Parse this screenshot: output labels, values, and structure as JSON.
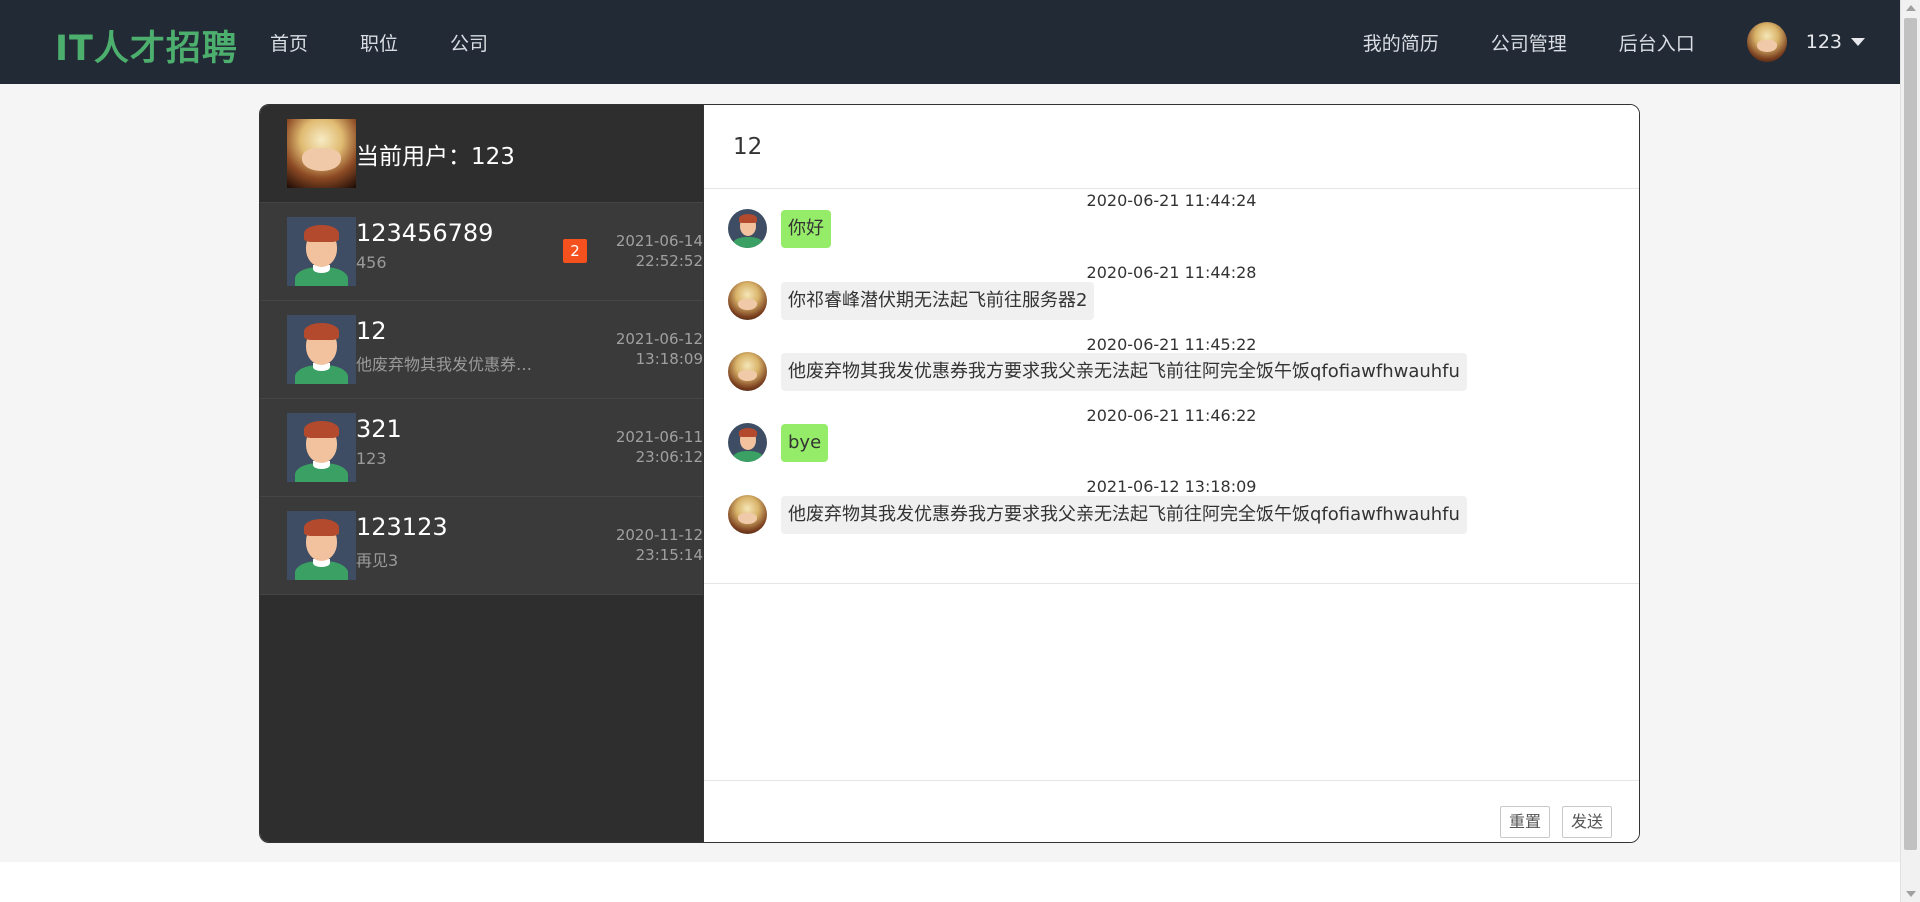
{
  "nav": {
    "brand": "IT人才招聘",
    "left_links": [
      "首页",
      "职位",
      "公司"
    ],
    "right_links": [
      "我的简历",
      "公司管理",
      "后台入口"
    ],
    "user_name": "123"
  },
  "sidebar": {
    "current_user_label": "当前用户：123",
    "contacts": [
      {
        "name": "123456789",
        "last_message": "456",
        "date": "2021-06-14",
        "time": "22:52:52",
        "badge": "2"
      },
      {
        "name": "12",
        "last_message": "他废弃物其我发优惠券…",
        "date": "2021-06-12",
        "time": "13:18:09"
      },
      {
        "name": "321",
        "last_message": "123",
        "date": "2021-06-11",
        "time": "23:06:12"
      },
      {
        "name": "123123",
        "last_message": "再见3",
        "date": "2020-11-12",
        "time": "23:15:14"
      }
    ]
  },
  "chat": {
    "title": "12",
    "messages": [
      {
        "timestamp": "2020-06-21 11:44:24",
        "text": "你好",
        "style": "green",
        "avatar": "male"
      },
      {
        "timestamp": "2020-06-21 11:44:28",
        "text": "你祁睿峰潜伏期无法起飞前往服务器2",
        "style": "grey",
        "avatar": "anime"
      },
      {
        "timestamp": "2020-06-21 11:45:22",
        "text": "他废弃物其我发优惠券我方要求我父亲无法起飞前往阿完全饭午饭qfofiawfhwauhfu",
        "style": "grey",
        "avatar": "anime"
      },
      {
        "timestamp": "2020-06-21 11:46:22",
        "text": "bye",
        "style": "green",
        "avatar": "male"
      },
      {
        "timestamp": "2021-06-12 13:18:09",
        "text": "他废弃物其我发优惠券我方要求我父亲无法起飞前往阿完全饭午饭qfofiawfhwauhfu",
        "style": "grey",
        "avatar": "anime"
      }
    ],
    "reset_label": "重置",
    "send_label": "发送"
  },
  "colors": {
    "topbar": "#222a36",
    "brand": "#4caf6e",
    "sidebar": "#2e2e2e",
    "bubble_green": "#95ec69",
    "bubble_grey": "#f0f0f0",
    "badge": "#f4511e"
  }
}
